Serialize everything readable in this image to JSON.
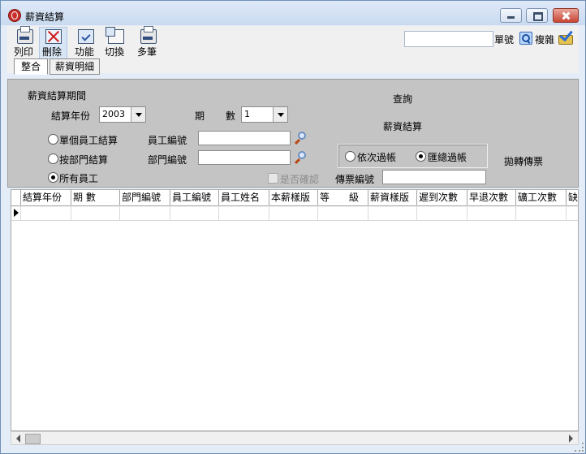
{
  "window": {
    "title": "薪資結算"
  },
  "toolbar": {
    "print": "列印",
    "delete": "刪除",
    "functions": "功能",
    "switch": "切換",
    "multi": "多筆",
    "search_label": "單號",
    "complex_label": "複雜"
  },
  "tabs": [
    "整合",
    "薪資明細"
  ],
  "params": {
    "period_section": "薪資結算期間",
    "year_label": "結算年份",
    "year_value": "2003",
    "period_label_1": "期",
    "period_label_2": "數",
    "period_value": "1",
    "query_label": "查詢",
    "calc_label": "薪資結算",
    "option_single": "單個員工結算",
    "option_dept": "按部門結算",
    "option_all": "所有員工",
    "employee_id_label": "員工編號",
    "dept_id_label": "部門編號",
    "post_by_order": "依次過帳",
    "post_summary": "匯總過帳",
    "throw_voucher": "拋轉傳票",
    "confirm_label": "是否確認",
    "voucher_no_label": "傳票編號"
  },
  "grid": {
    "columns": [
      "結算年份",
      "期 數",
      "部門編號",
      "員工編號",
      "員工姓名",
      "本薪樣版",
      "等　　級",
      "薪資樣版",
      "遲到次數",
      "早退次數",
      "礦工次數",
      "缺"
    ]
  }
}
